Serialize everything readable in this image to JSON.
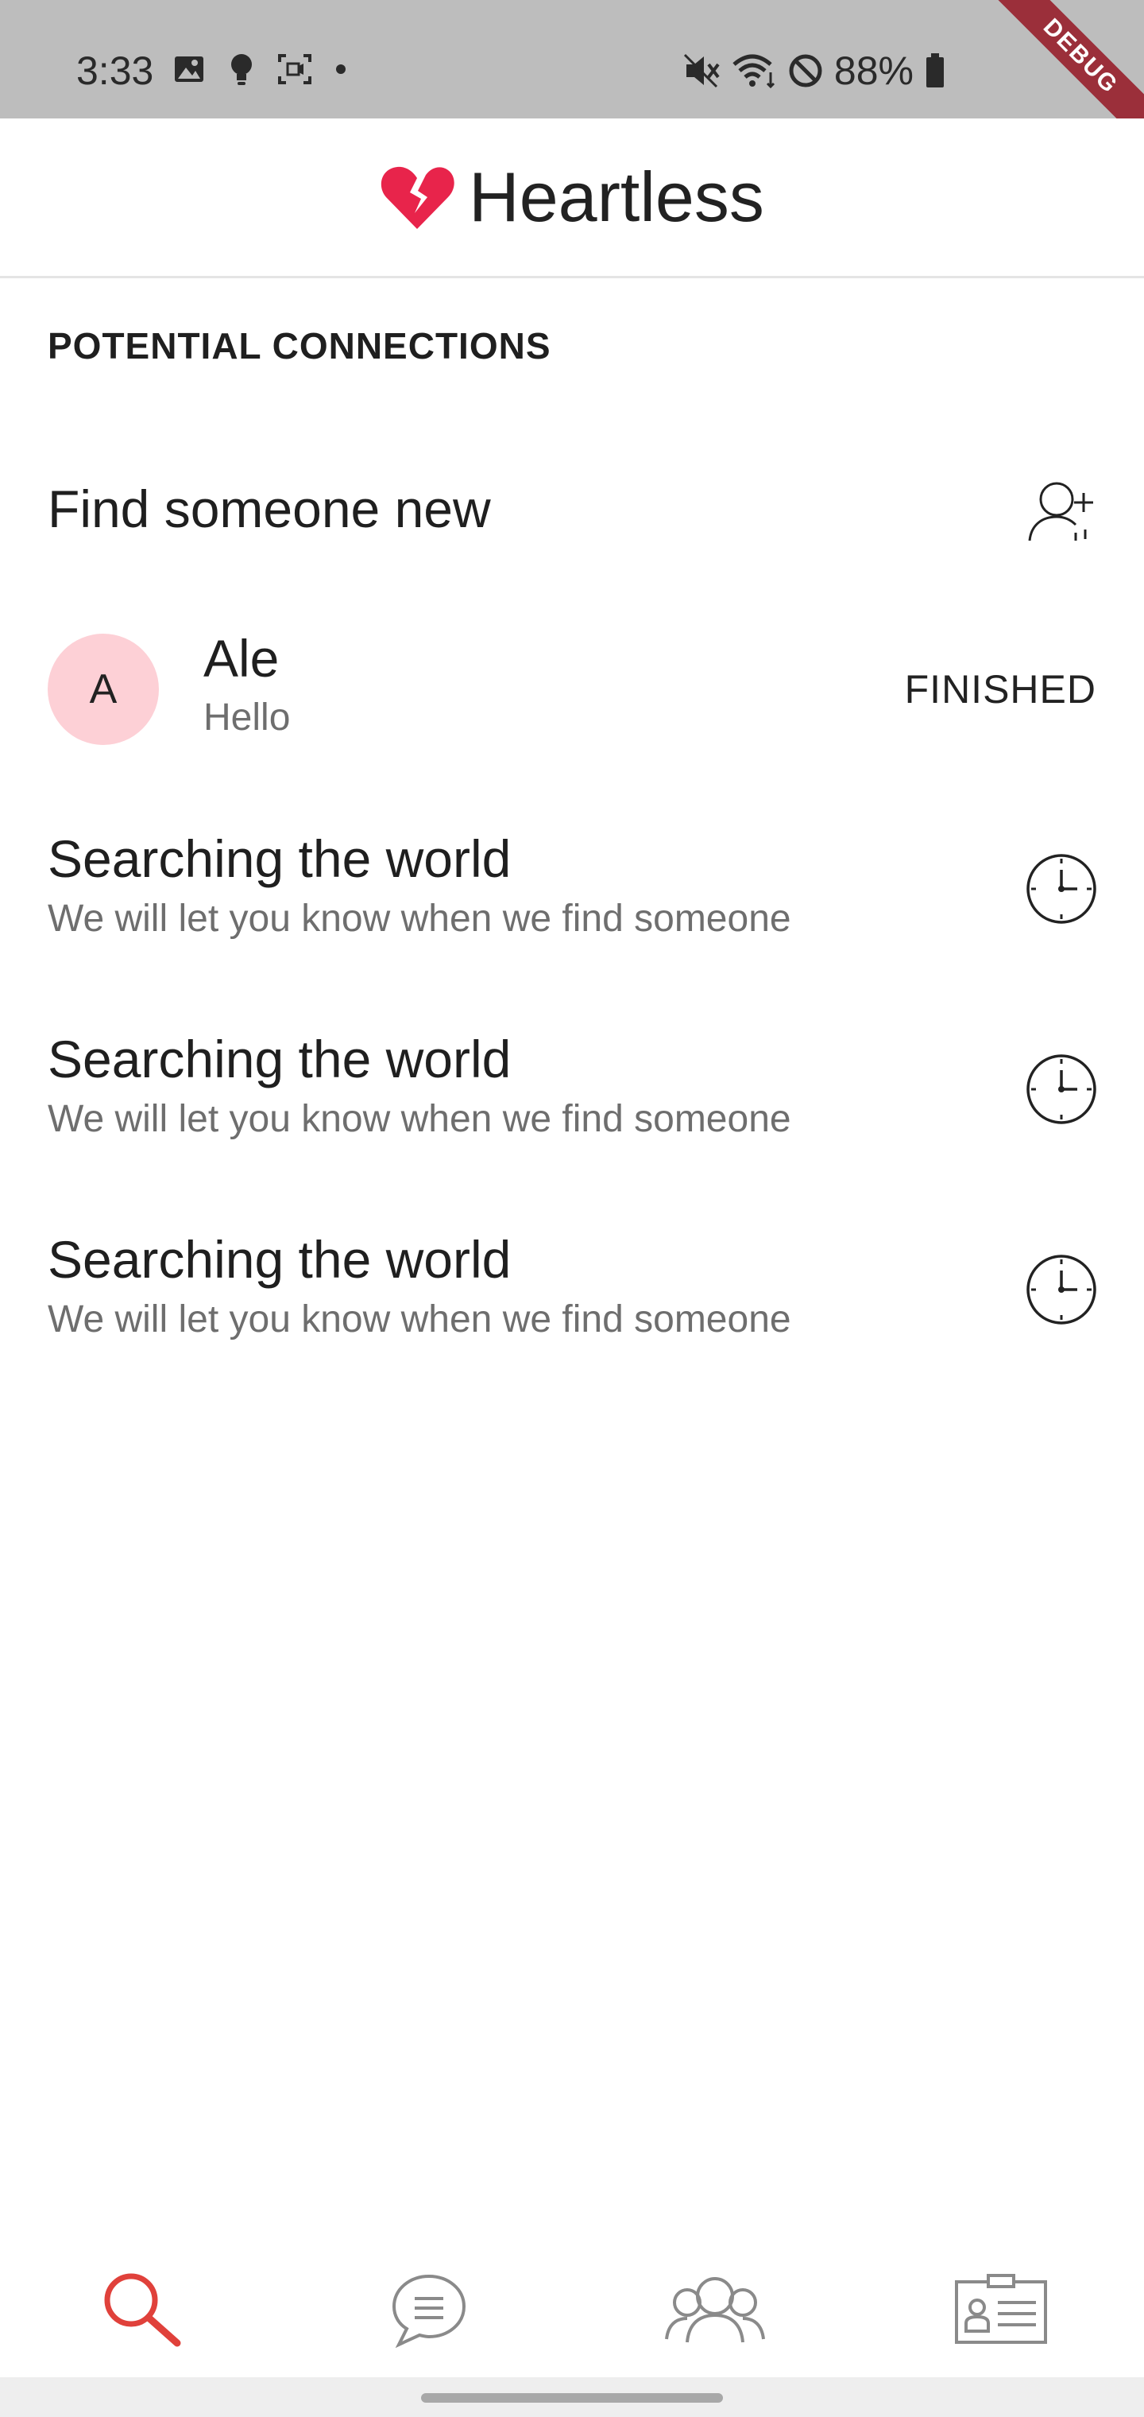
{
  "status_bar": {
    "time": "3:33",
    "battery": "88%",
    "icons": [
      "image-icon",
      "bulb-icon",
      "screen-capture-icon",
      "dot-icon",
      "mute-icon",
      "wifi-icon",
      "do-not-disturb-icon",
      "battery-icon"
    ]
  },
  "debug_ribbon": "DEBUG",
  "app_bar": {
    "title": "Heartless",
    "logo_icon": "broken-heart-icon",
    "logo_color": "#e8244b"
  },
  "section": {
    "header": "POTENTIAL CONNECTIONS"
  },
  "find_row": {
    "title": "Find someone new",
    "icon": "add-person-icon"
  },
  "connections": [
    {
      "avatar_letter": "A",
      "name": "Ale",
      "message": "Hello",
      "status": "FINISHED",
      "avatar_color": "#fdd0d6"
    }
  ],
  "searching": [
    {
      "title": "Searching the world",
      "subtitle": "We will let you know when we find someone",
      "icon": "clock-icon"
    },
    {
      "title": "Searching the world",
      "subtitle": "We will let you know when we find someone",
      "icon": "clock-icon"
    },
    {
      "title": "Searching the world",
      "subtitle": "We will let you know when we find someone",
      "icon": "clock-icon"
    }
  ],
  "bottom_nav": {
    "items": [
      {
        "name": "search",
        "icon": "search-icon",
        "active": true
      },
      {
        "name": "chats",
        "icon": "chat-icon",
        "active": false
      },
      {
        "name": "connections",
        "icon": "people-icon",
        "active": false
      },
      {
        "name": "profile",
        "icon": "id-card-icon",
        "active": false
      }
    ],
    "active_color": "#e0413b",
    "inactive_color": "#8a8a8a"
  }
}
